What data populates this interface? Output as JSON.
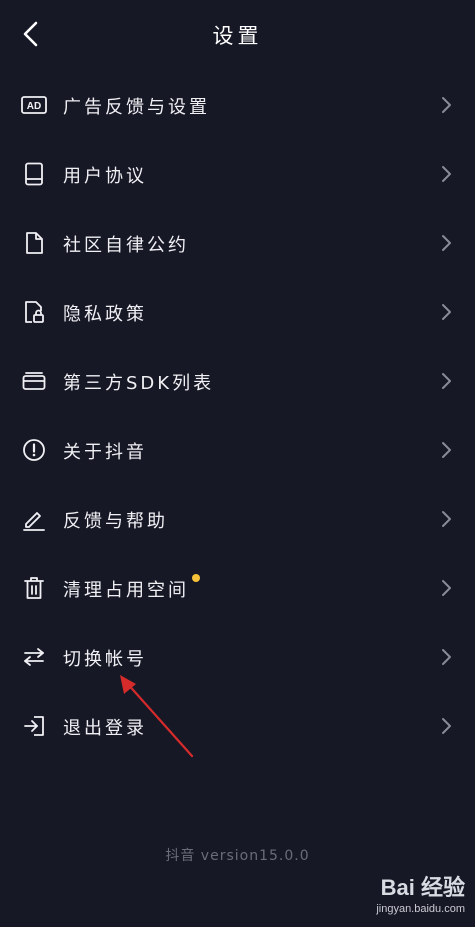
{
  "header": {
    "title": "设置"
  },
  "menu": {
    "items": [
      {
        "label": "广告反馈与设置",
        "icon": "ad-icon"
      },
      {
        "label": "用户协议",
        "icon": "book-icon"
      },
      {
        "label": "社区自律公约",
        "icon": "document-icon"
      },
      {
        "label": "隐私政策",
        "icon": "privacy-lock-icon"
      },
      {
        "label": "第三方SDK列表",
        "icon": "card-icon"
      },
      {
        "label": "关于抖音",
        "icon": "info-icon"
      },
      {
        "label": "反馈与帮助",
        "icon": "pencil-icon"
      },
      {
        "label": "清理占用空间",
        "icon": "trash-icon"
      },
      {
        "label": "切换帐号",
        "icon": "switch-arrows-icon"
      },
      {
        "label": "退出登录",
        "icon": "logout-icon"
      }
    ]
  },
  "footer": {
    "version": "抖音 version15.0.0"
  },
  "watermark": {
    "logo": "Bai 经验",
    "sub": "jingyan.baidu.com"
  },
  "colors": {
    "background": "#171826",
    "text": "#f0f0f4",
    "chevron": "#8a8b96",
    "dot": "#f5c23a",
    "annotation_arrow": "#d62b2b"
  }
}
